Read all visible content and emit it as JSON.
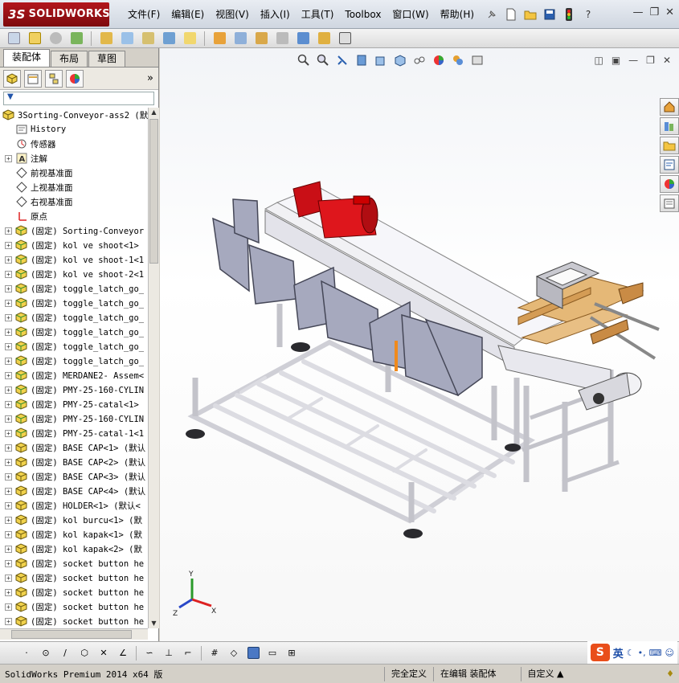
{
  "app": {
    "logo_text": "SOLIDWORKS",
    "logo_prefix": "3S",
    "menu": [
      "文件(F)",
      "编辑(E)",
      "视图(V)",
      "插入(I)",
      "工具(T)",
      "Toolbox",
      "窗口(W)",
      "帮助(H)"
    ],
    "help_glyph": "?"
  },
  "left_tabs": [
    "装配体",
    "布局",
    "草图"
  ],
  "tree": {
    "root": "3Sorting-Conveyor-ass2  (默",
    "items": [
      {
        "label": "History",
        "icon": "history-icon",
        "expandable": false
      },
      {
        "label": "传感器",
        "icon": "sensor-icon",
        "expandable": false
      },
      {
        "label": "注解",
        "icon": "annotation-icon",
        "expandable": true
      },
      {
        "label": "前视基准面",
        "icon": "plane-icon",
        "expandable": false
      },
      {
        "label": "上视基准面",
        "icon": "plane-icon",
        "expandable": false
      },
      {
        "label": "右视基准面",
        "icon": "plane-icon",
        "expandable": false
      },
      {
        "label": "原点",
        "icon": "origin-icon",
        "expandable": false
      },
      {
        "label": "(固定) Sorting-Conveyor",
        "icon": "subassembly-icon",
        "expandable": true
      },
      {
        "label": "(固定) kol ve shoot<1>",
        "icon": "subassembly-icon",
        "expandable": true
      },
      {
        "label": "(固定) kol ve shoot-1<1",
        "icon": "subassembly-icon",
        "expandable": true
      },
      {
        "label": "(固定) kol ve shoot-2<1",
        "icon": "subassembly-icon",
        "expandable": true
      },
      {
        "label": "(固定) toggle_latch_go_",
        "icon": "subassembly-icon",
        "expandable": true
      },
      {
        "label": "(固定) toggle_latch_go_",
        "icon": "subassembly-icon",
        "expandable": true
      },
      {
        "label": "(固定) toggle_latch_go_",
        "icon": "subassembly-icon",
        "expandable": true
      },
      {
        "label": "(固定) toggle_latch_go_",
        "icon": "subassembly-icon",
        "expandable": true
      },
      {
        "label": "(固定) toggle_latch_go_",
        "icon": "subassembly-icon",
        "expandable": true
      },
      {
        "label": "(固定) toggle_latch_go_",
        "icon": "subassembly-icon",
        "expandable": true
      },
      {
        "label": "(固定) MERDANE2- Assem<",
        "icon": "subassembly-icon",
        "expandable": true
      },
      {
        "label": "(固定) PMY-25-160-CYLIN",
        "icon": "subassembly-icon",
        "expandable": true
      },
      {
        "label": "(固定) PMY-25-catal<1>",
        "icon": "subassembly-icon",
        "expandable": true
      },
      {
        "label": "(固定) PMY-25-160-CYLIN",
        "icon": "subassembly-icon",
        "expandable": true
      },
      {
        "label": "(固定) PMY-25-catal-1<1",
        "icon": "subassembly-icon",
        "expandable": true
      },
      {
        "label": "(固定) BASE CAP<1> (默认",
        "icon": "part-icon",
        "expandable": true
      },
      {
        "label": "(固定) BASE CAP<2> (默认",
        "icon": "part-icon",
        "expandable": true
      },
      {
        "label": "(固定) BASE CAP<3> (默认",
        "icon": "part-icon",
        "expandable": true
      },
      {
        "label": "(固定) BASE CAP<4> (默认",
        "icon": "part-icon",
        "expandable": true
      },
      {
        "label": "(固定) HOLDER<1> (默认<",
        "icon": "part-icon",
        "expandable": true
      },
      {
        "label": "(固定) kol burcu<1> (默",
        "icon": "part-icon",
        "expandable": true
      },
      {
        "label": "(固定) kol kapak<1> (默",
        "icon": "part-icon",
        "expandable": true
      },
      {
        "label": "(固定) kol kapak<2> (默",
        "icon": "part-icon",
        "expandable": true
      },
      {
        "label": "(固定) socket button he",
        "icon": "part-icon",
        "expandable": true
      },
      {
        "label": "(固定) socket button he",
        "icon": "part-icon",
        "expandable": true
      },
      {
        "label": "(固定) socket button he",
        "icon": "part-icon",
        "expandable": true
      },
      {
        "label": "(固定) socket button he",
        "icon": "part-icon",
        "expandable": true
      },
      {
        "label": "(固定) socket button he",
        "icon": "part-icon",
        "expandable": true
      }
    ]
  },
  "triad": {
    "x": "X",
    "y": "Y",
    "z": "Z"
  },
  "ime": {
    "mode": "英"
  },
  "status": {
    "version": "SolidWorks Premium 2014 x64 版",
    "defined": "完全定义",
    "editing": "在编辑 装配体",
    "custom": "自定义"
  },
  "colors": {
    "brand": "#b3161c",
    "motor": "#d8131a",
    "frame": "#e8e8ec",
    "chute": "#a9acc0",
    "wood": "#e5b877"
  }
}
